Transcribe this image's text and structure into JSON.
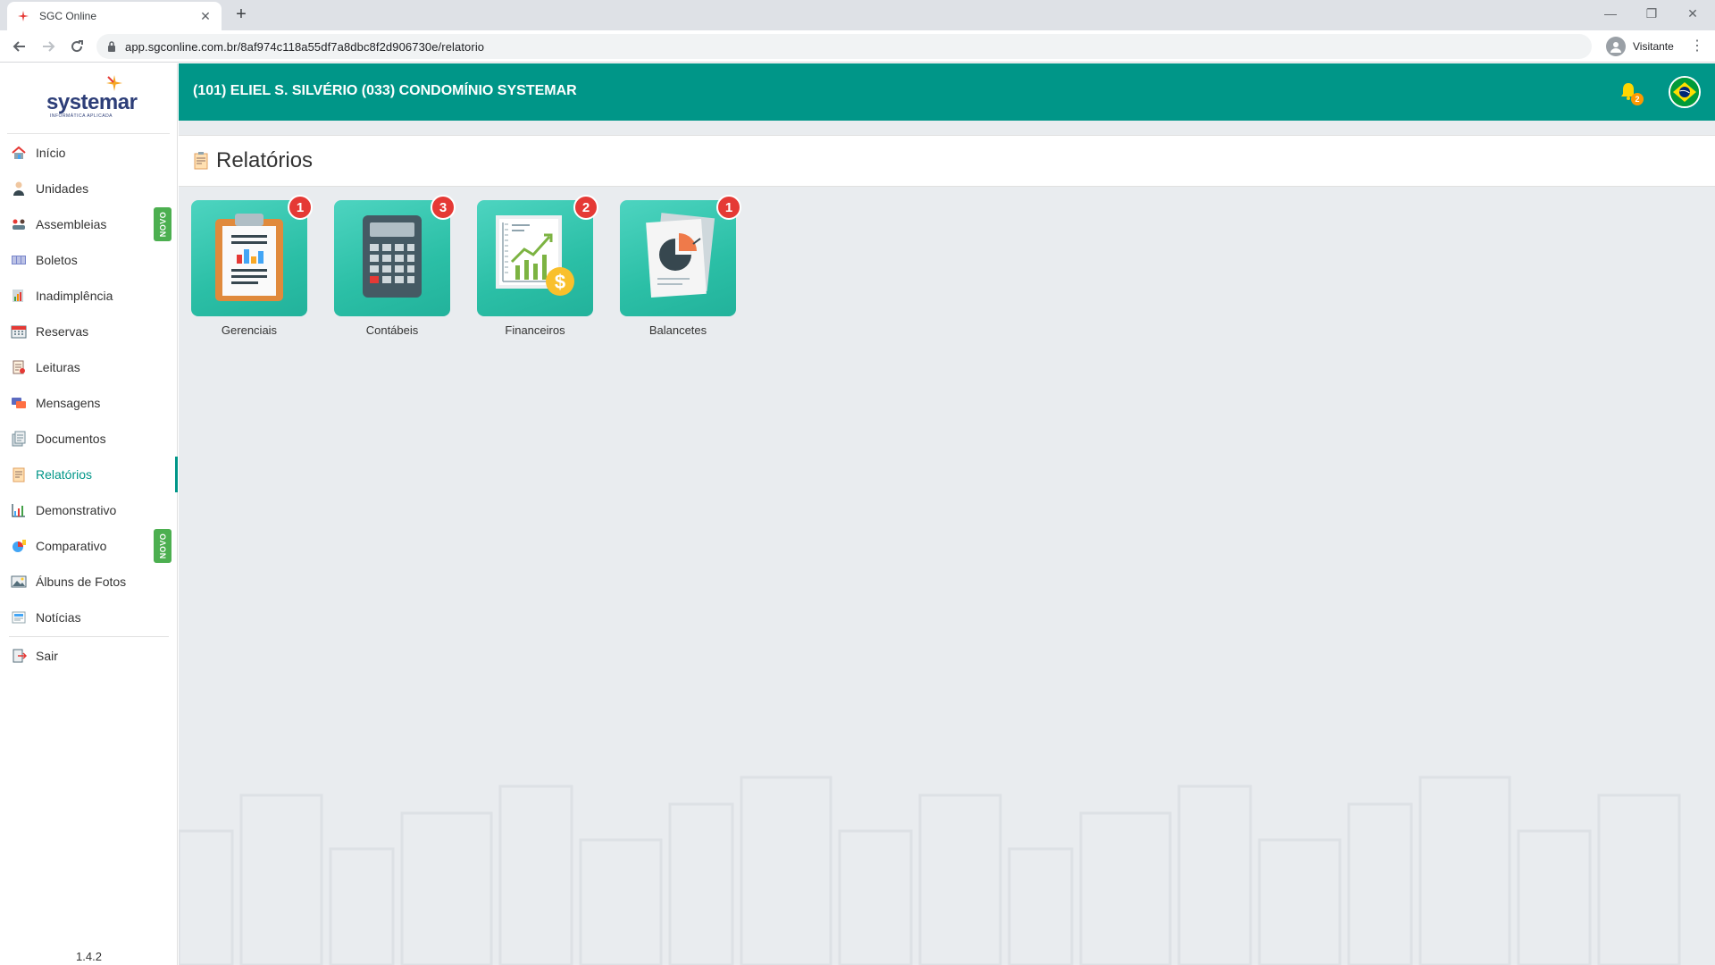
{
  "browser": {
    "tab_title": "SGC Online",
    "url": "app.sgconline.com.br/8af974c118a55df7a8dbc8f2d906730e/relatorio",
    "profile_name": "Visitante"
  },
  "brand": {
    "logo_text": "systemar",
    "logo_sub": "INFORMÁTICA APLICADA",
    "accent_color": "#009688",
    "novo_color": "#4caf50",
    "badge_color": "#e53935"
  },
  "header": {
    "title": "(101) ELIEL S. SILVÉRIO  (033) CONDOMÍNIO SYSTEMAR",
    "notification_count": "2"
  },
  "sidebar": {
    "items": [
      {
        "label": "Início",
        "icon": "home-icon"
      },
      {
        "label": "Unidades",
        "icon": "user-icon"
      },
      {
        "label": "Assembleias",
        "icon": "meeting-icon",
        "badge": "NOVO"
      },
      {
        "label": "Boletos",
        "icon": "barcode-icon"
      },
      {
        "label": "Inadimplência",
        "icon": "debt-icon"
      },
      {
        "label": "Reservas",
        "icon": "calendar-icon"
      },
      {
        "label": "Leituras",
        "icon": "reading-icon"
      },
      {
        "label": "Mensagens",
        "icon": "messages-icon"
      },
      {
        "label": "Documentos",
        "icon": "documents-icon"
      },
      {
        "label": "Relatórios",
        "icon": "report-icon",
        "active": true
      },
      {
        "label": "Demonstrativo",
        "icon": "chart-icon"
      },
      {
        "label": "Comparativo",
        "icon": "pie-chart-icon",
        "badge": "NOVO"
      },
      {
        "label": "Álbuns de Fotos",
        "icon": "photo-icon"
      },
      {
        "label": "Notícias",
        "icon": "news-icon"
      },
      {
        "label": "Sair",
        "icon": "exit-icon"
      }
    ],
    "version": "1.4.2"
  },
  "page": {
    "title": "Relatórios",
    "cards": [
      {
        "label": "Gerenciais",
        "count": "1",
        "icon": "clipboard-report-icon"
      },
      {
        "label": "Contábeis",
        "count": "3",
        "icon": "calculator-icon"
      },
      {
        "label": "Financeiros",
        "count": "2",
        "icon": "financial-chart-icon"
      },
      {
        "label": "Balancetes",
        "count": "1",
        "icon": "balance-pie-icon"
      }
    ]
  }
}
